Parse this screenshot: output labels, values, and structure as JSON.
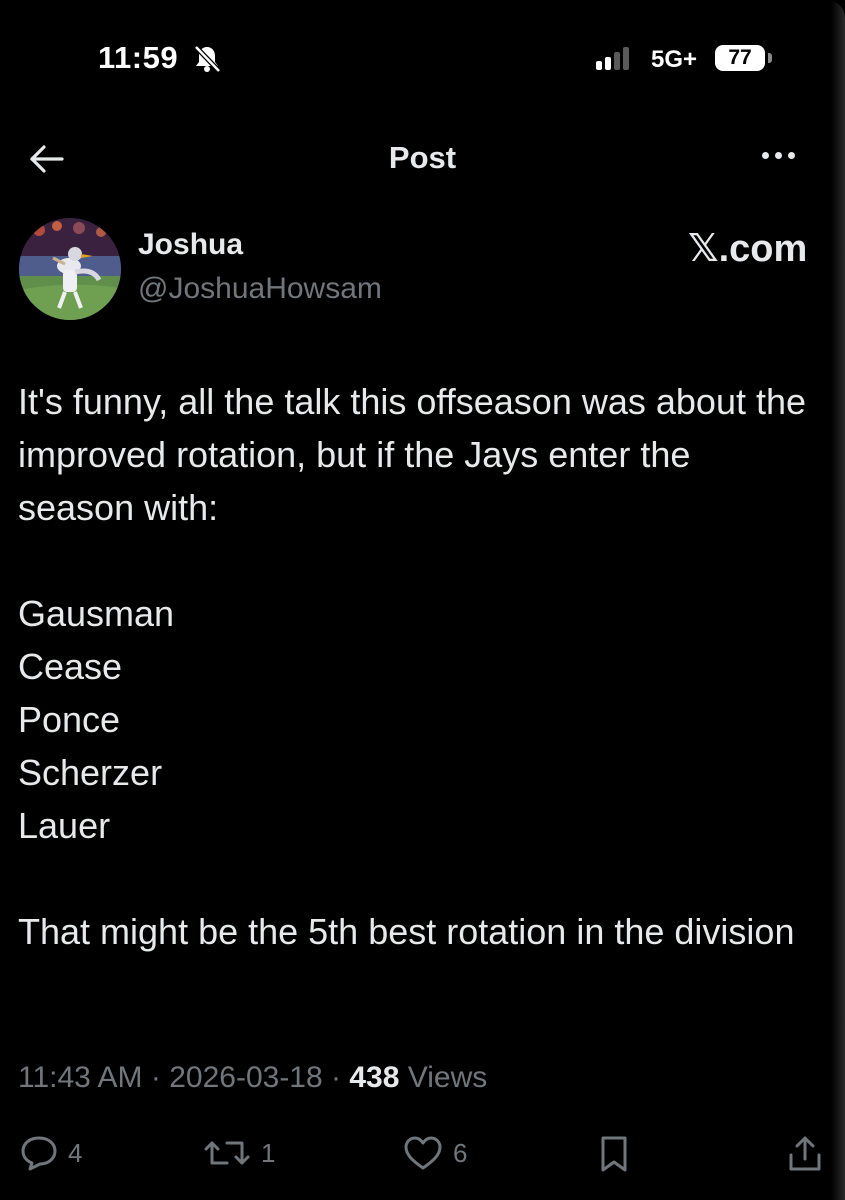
{
  "status_bar": {
    "time": "11:59",
    "network": "5G+",
    "battery": "77",
    "icons": [
      "bell-slash-icon",
      "signal-bars-icon",
      "battery-icon"
    ]
  },
  "header": {
    "title": "Post",
    "back_icon": "arrow-left-icon",
    "more_icon": "more-dots-icon"
  },
  "post": {
    "author_name": "Joshua",
    "author_handle": "@JoshuaHowsam",
    "source_brand": "𝕏.com",
    "paragraphs": [
      "It's funny, all the talk this offseason was about the improved rotation, but if the Jays enter the season with:",
      "Gausman\nCease\nPonce\nScherzer\nLauer",
      "That might be the 5th best rotation in the division"
    ],
    "time": "11:43 AM",
    "date": "2026-03-18",
    "views_count": "438",
    "views_label": "Views",
    "separator": "·"
  },
  "actions": {
    "reply_count": "4",
    "repost_count": "1",
    "like_count": "6",
    "icons": [
      "reply-icon",
      "repost-icon",
      "like-icon",
      "bookmark-icon",
      "share-icon"
    ]
  },
  "colors": {
    "background": "#000000",
    "text": "#e7e9ea",
    "secondary_text": "#71767b"
  }
}
